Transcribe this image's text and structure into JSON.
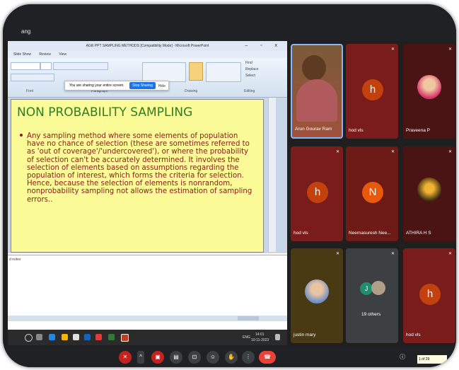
{
  "meeting": {
    "presenter_label": "ang"
  },
  "ppt": {
    "title": "AGR PPT SAMPLING METHODS [Compatibility Mode] - Microsoft PowerPoint",
    "window_buttons": "– ▫ x",
    "tabs": [
      "Slide Show",
      "Review",
      "View"
    ],
    "group_labels": [
      "Font",
      "Paragraph",
      "Drawing",
      "Editing"
    ],
    "editing_items": [
      "Find",
      "Replace",
      "Select"
    ],
    "share_banner": {
      "text": "You are sharing your entire screen.",
      "stop": "Stop Sharing",
      "hide": "Hide"
    },
    "slide": {
      "title": "NON PROBABILITY SAMPLING",
      "body": "Any sampling method where some elements of population have no chance of selection (these are sometimes referred to as 'out of coverage'/'undercovered'), or where the probability of selection can't be accurately determined. It involves the selection of elements based on assumptions regarding the population of interest, which forms the criteria for selection. Hence, because the selection of elements is nonrandom, nonprobability sampling not allows the estimation of sampling errors.."
    },
    "notes_label": "d notes"
  },
  "taskbar": {
    "time": "14:01",
    "date": "10-11-2023",
    "lang": "ENG"
  },
  "participants": [
    {
      "name": "Arun Gourav Ram",
      "kind": "video"
    },
    {
      "name": "hod vls",
      "letter": "h",
      "color": "#c2410c"
    },
    {
      "name": "Praveena P",
      "kind": "photo"
    },
    {
      "name": "hod vls",
      "letter": "h",
      "color": "#c2410c"
    },
    {
      "name": "Neemasuresh Nee...",
      "letter": "N",
      "color": "#e8590c"
    },
    {
      "name": "ATHIRA H S",
      "kind": "photo"
    },
    {
      "name": "justin mary",
      "kind": "photo"
    },
    {
      "name": "19 others",
      "kind": "others"
    },
    {
      "name": "hod vls",
      "letter": "h",
      "color": "#c2410c"
    }
  ],
  "others_letter": "J",
  "page_indicator": "1 of 29"
}
